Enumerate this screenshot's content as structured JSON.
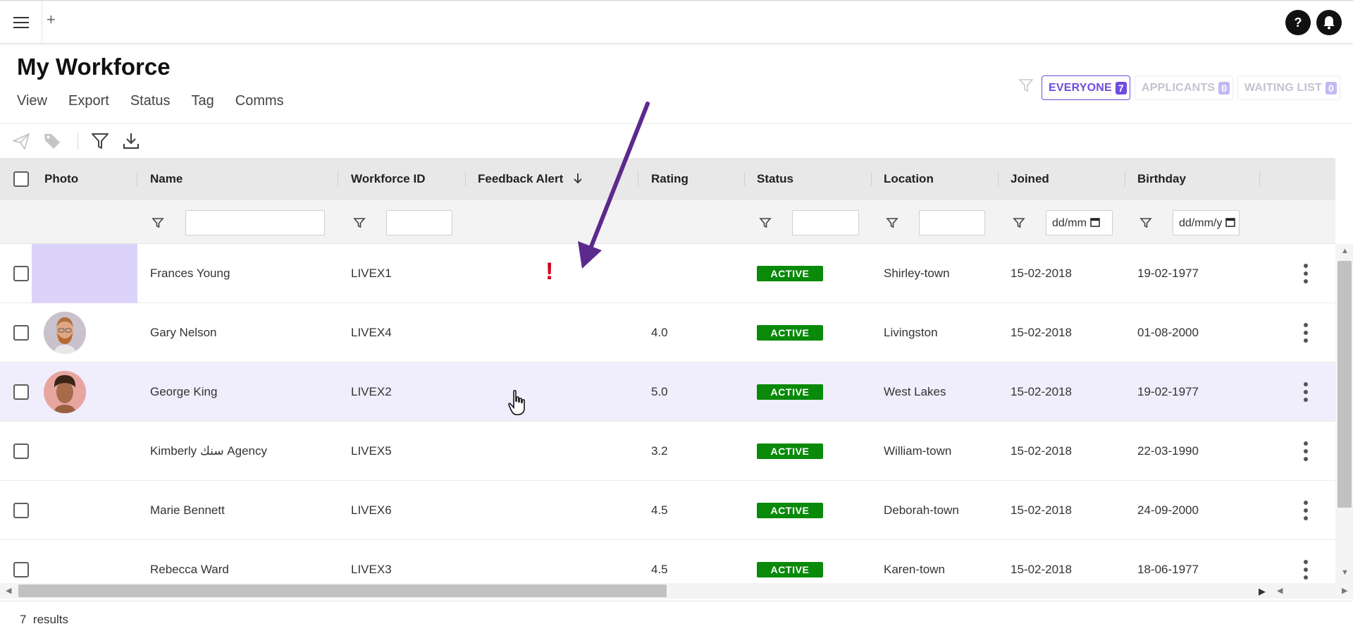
{
  "header": {
    "menu_icon": "hamburger-icon",
    "add_label": "+",
    "help_label": "?",
    "bell_icon": "bell-icon"
  },
  "page": {
    "title": "My Workforce",
    "menu": [
      "View",
      "Export",
      "Status",
      "Tag",
      "Comms"
    ]
  },
  "segments": [
    {
      "label": "EVERYONE",
      "count": "7",
      "active": true
    },
    {
      "label": "APPLICANTS",
      "count": "0",
      "active": false
    },
    {
      "label": "WAITING LIST",
      "count": "0",
      "active": false
    }
  ],
  "toolbar": {
    "icons": [
      "send-icon",
      "tag-icon",
      "filter-icon",
      "download-icon"
    ]
  },
  "table": {
    "columns": {
      "photo": "Photo",
      "name": "Name",
      "workforce_id": "Workforce ID",
      "feedback_alert": "Feedback Alert",
      "rating": "Rating",
      "status": "Status",
      "location": "Location",
      "joined": "Joined",
      "birthday": "Birthday"
    },
    "sort": {
      "column": "Feedback Alert",
      "direction": "descending"
    },
    "date_placeholders": {
      "joined": "dd/mm",
      "birthday": "dd/mm/y"
    },
    "rows": [
      {
        "name": "Frances Young",
        "id": "LIVEX1",
        "alert": "!",
        "rating": "",
        "status": "ACTIVE",
        "location": "Shirley-town",
        "joined": "15-02-2018",
        "birthday": "19-02-1977"
      },
      {
        "name": "Gary Nelson",
        "id": "LIVEX4",
        "alert": "",
        "rating": "4.0",
        "status": "ACTIVE",
        "location": "Livingston",
        "joined": "15-02-2018",
        "birthday": "01-08-2000"
      },
      {
        "name": "George King",
        "id": "LIVEX2",
        "alert": "",
        "rating": "5.0",
        "status": "ACTIVE",
        "location": "West Lakes",
        "joined": "15-02-2018",
        "birthday": "19-02-1977"
      },
      {
        "name": "Kimberly سنك Agency",
        "id": "LIVEX5",
        "alert": "",
        "rating": "3.2",
        "status": "ACTIVE",
        "location": "William-town",
        "joined": "15-02-2018",
        "birthday": "22-03-1990"
      },
      {
        "name": "Marie Bennett",
        "id": "LIVEX6",
        "alert": "",
        "rating": "4.5",
        "status": "ACTIVE",
        "location": "Deborah-town",
        "joined": "15-02-2018",
        "birthday": "24-09-2000"
      },
      {
        "name": "Rebecca Ward",
        "id": "LIVEX3",
        "alert": "",
        "rating": "4.5",
        "status": "ACTIVE",
        "location": "Karen-town",
        "joined": "15-02-2018",
        "birthday": "18-06-1977"
      }
    ]
  },
  "footer": {
    "count": "7",
    "results_label": "results"
  },
  "colors": {
    "accent": "#6d4de0",
    "status_active": "#0a8a0a",
    "annotation_arrow": "#5b2a8c",
    "alert": "#d0021b"
  }
}
